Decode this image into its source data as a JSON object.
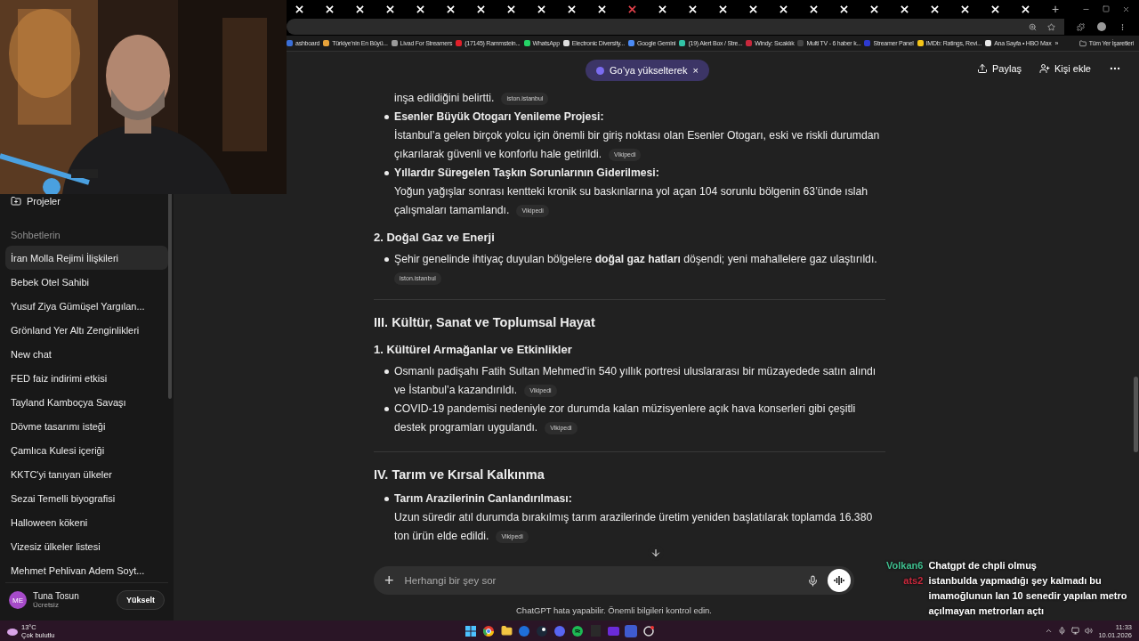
{
  "browser": {
    "tabs": [
      {
        "color": "#ffffff"
      },
      {
        "color": "#ffffff"
      },
      {
        "color": "#ffffff"
      },
      {
        "color": "#ffffff"
      },
      {
        "color": "#ffffff"
      },
      {
        "color": "#ffffff"
      },
      {
        "color": "#ffffff"
      },
      {
        "color": "#ffffff"
      },
      {
        "color": "#ffffff"
      },
      {
        "color": "#ffffff"
      },
      {
        "color": "#ffffff"
      },
      {
        "color": "#e0404a"
      },
      {
        "color": "#ffffff"
      },
      {
        "color": "#ffffff"
      },
      {
        "color": "#ffffff"
      },
      {
        "color": "#ffffff"
      },
      {
        "color": "#ffffff"
      },
      {
        "color": "#ffffff"
      },
      {
        "color": "#ffffff"
      },
      {
        "color": "#ffffff"
      },
      {
        "color": "#ffffff"
      },
      {
        "color": "#ffffff"
      },
      {
        "color": "#ffffff"
      },
      {
        "color": "#ffffff"
      },
      {
        "color": "#ffffff"
      }
    ],
    "new_tab": "+",
    "bookmarks": [
      {
        "label": "ashboard",
        "color": "#3a6fd8"
      },
      {
        "label": "Türkiye'nin En Büyü...",
        "color": "#e8a33a"
      },
      {
        "label": "Livad For Streamers",
        "color": "#9a9a9a"
      },
      {
        "label": "(17145) Rammstein...",
        "color": "#e0202a"
      },
      {
        "label": "WhatsApp",
        "color": "#25d366"
      },
      {
        "label": "Electronic Diversity...",
        "color": "#dddddd"
      },
      {
        "label": "Google Gemini",
        "color": "#4b8bf5"
      },
      {
        "label": "(19) Alert Box / Stre...",
        "color": "#32c3a6"
      },
      {
        "label": "Windy: Sıcaklık",
        "color": "#c8283c"
      },
      {
        "label": "Multi TV - 6 haber k...",
        "color": "#444444"
      },
      {
        "label": "Streamer Panel",
        "color": "#2d3ad0"
      },
      {
        "label": "IMDb: Ratings, Revi...",
        "color": "#f5c518"
      },
      {
        "label": "Ana Sayfa • HBO Max",
        "color": "#e6e6e6"
      }
    ],
    "bookmarks_more": "»",
    "all_bookmarks": "Tüm Yer İşaretleri"
  },
  "header": {
    "upgrade_badge": "Go’ya yükselterek",
    "badge_close": "×",
    "share": "Paylaş",
    "add_person": "Kişi ekle"
  },
  "sidebar": {
    "projects": "Projeler",
    "section": "Sohbetlerin",
    "chats": [
      {
        "title": "İran Molla Rejimi İlişkileri",
        "selected": true
      },
      {
        "title": "Bebek Otel Sahibi",
        "selected": false
      },
      {
        "title": "Yusuf Ziya Gümüşel Yargılan...",
        "selected": false
      },
      {
        "title": "Grönland Yer Altı Zenginlikleri",
        "selected": false
      },
      {
        "title": "New chat",
        "selected": false
      },
      {
        "title": "FED faiz indirimi etkisi",
        "selected": false
      },
      {
        "title": "Tayland Kamboçya Savaşı",
        "selected": false
      },
      {
        "title": "Dövme tasarımı isteği",
        "selected": false
      },
      {
        "title": "Çamlıca Kulesi içeriği",
        "selected": false
      },
      {
        "title": "KKTC'yi tanıyan ülkeler",
        "selected": false
      },
      {
        "title": "Sezai Temelli biyografisi",
        "selected": false
      },
      {
        "title": "Halloween kökeni",
        "selected": false
      },
      {
        "title": "Vizesiz ülkeler listesi",
        "selected": false
      },
      {
        "title": "Mehmet Pehlivan Adem Soyt...",
        "selected": false
      }
    ],
    "user": {
      "initials": "ME",
      "name": "Tuna Tosun",
      "plan": "Ücretsiz",
      "upgrade": "Yükselt"
    }
  },
  "content": [
    {
      "kind": "tail",
      "text": "inşa edildiğini belirtti.",
      "source": "iston.istanbul"
    },
    {
      "kind": "bullet",
      "title": "Esenler Büyük Otogarı Yenileme Projesi:",
      "text": "İstanbul’a gelen birçok yolcu için önemli bir giriş noktası olan Esenler Otogarı, eski ve riskli durumdan çıkarılarak güvenli ve konforlu hale getirildi.",
      "source": "Vikipedi"
    },
    {
      "kind": "bullet",
      "title": "Yıllardır Süregelen Taşkın Sorunlarının Giderilmesi:",
      "text": "Yoğun yağışlar sonrası kentteki kronik su baskınlarına yol açan 104 sorunlu bölgenin 63’ünde ıslah çalışmaları tamamlandı.",
      "source": "Vikipedi"
    },
    {
      "kind": "subheading",
      "text": "2. Doğal Gaz ve Enerji"
    },
    {
      "kind": "bullet",
      "text": "Şehir genelinde ihtiyaç duyulan bölgelere **doğal gaz hatları** döşendi; yeni mahallelere gaz ulaştırıldı.",
      "source": "iston.istanbul"
    },
    {
      "kind": "divider"
    },
    {
      "kind": "heading",
      "text": "III. Kültür, Sanat ve Toplumsal Hayat"
    },
    {
      "kind": "subheading",
      "text": "1. Kültürel Armağanlar ve Etkinlikler"
    },
    {
      "kind": "bullet",
      "text": "Osmanlı padişahı Fatih Sultan Mehmed’in 540 yıllık portresi uluslararası bir müzayedede satın alındı ve İstanbul’a kazandırıldı.",
      "source": "Vikipedi"
    },
    {
      "kind": "bullet",
      "text": "COVID-19 pandemisi nedeniyle zor durumda kalan müzisyenlere açık hava konserleri gibi çeşitli destek programları uygulandı.",
      "source": "Vikipedi"
    },
    {
      "kind": "divider"
    },
    {
      "kind": "heading",
      "text": "IV. Tarım ve Kırsal Kalkınma"
    },
    {
      "kind": "bullet",
      "title": "Tarım Arazilerinin Canlandırılması:",
      "text": "Uzun süredir atıl durumda bırakılmış tarım arazilerinde üretim yeniden başlatılarak toplamda 16.380 ton ürün elde edildi.",
      "source": "Vikipedi"
    }
  ],
  "composer": {
    "plus": "+",
    "placeholder": "Herhangi bir şey sor"
  },
  "disclaimer": "ChatGPT hata yapabilir. Önemli bilgileri kontrol edin.",
  "stream_chat": [
    {
      "user": "Volkan6",
      "color": "#3fbf8f",
      "text": "Chatgpt de chpli olmuş"
    },
    {
      "user": "ats2",
      "color": "#c8283c",
      "text": "istanbulda yapmadığı şey kalmadı bu imamoğlunun lan 10 senedir yapılan metro açılmayan metrorları açtı"
    }
  ],
  "taskbar": {
    "temperature": "13°C",
    "weather": "Çok bulutlu",
    "time": "11:33",
    "date": "10.01.2026"
  }
}
